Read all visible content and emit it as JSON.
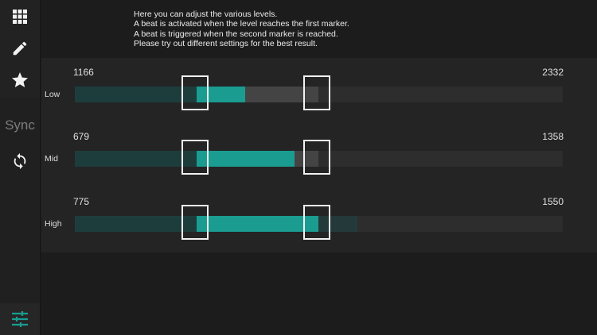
{
  "sidebar": {
    "items": [
      {
        "name": "grid",
        "icon": "grid-icon"
      },
      {
        "name": "edit",
        "icon": "pencil-icon"
      },
      {
        "name": "favorites",
        "icon": "star-icon"
      }
    ],
    "sync_label": "Sync",
    "sync_icon": "sync-icon",
    "settings_icon": "sliders-icon"
  },
  "intro": {
    "lines": [
      "Here you can adjust the various levels.",
      "A beat is activated when the level reaches the first marker.",
      "A beat is triggered when the second marker is reached.",
      "Please try out different settings for the best result."
    ]
  },
  "levels": [
    {
      "label": "Low",
      "min": "1166",
      "max": "2332",
      "active_start": 0.25,
      "active_end": 0.35,
      "grey_end": 0.5
    },
    {
      "label": "Mid",
      "min": "679",
      "max": "1358",
      "active_start": 0.25,
      "active_end": 0.45,
      "grey_end": 0.5
    },
    {
      "label": "High",
      "min": "775",
      "max": "1550",
      "active_start": 0.25,
      "active_end": 0.5,
      "grey_end": 0.58
    }
  ],
  "colors": {
    "teal": "#1a9c91",
    "teal_dark": "#1d3d3d",
    "teal_faint": "#243a3a",
    "grey_fill": "#444444",
    "track": "#2d2d2d",
    "marker": "#f2f2f2"
  }
}
